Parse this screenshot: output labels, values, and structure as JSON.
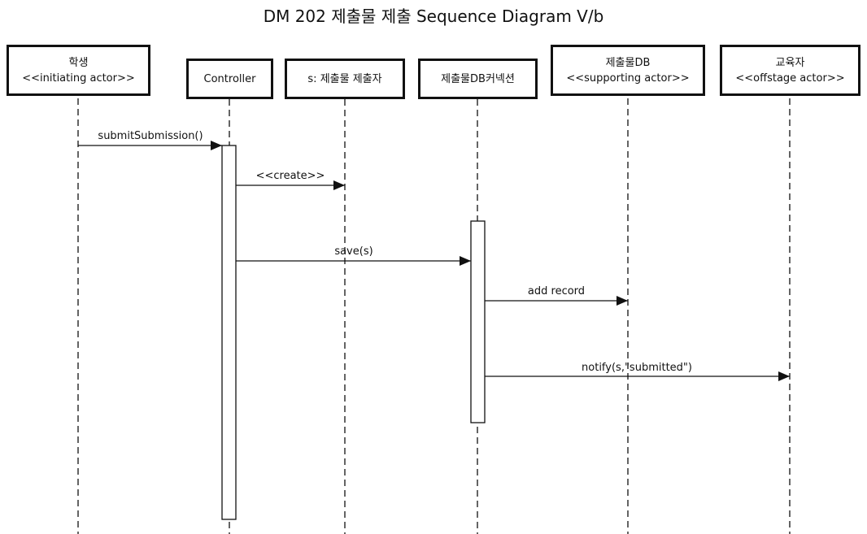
{
  "title": "DM 202 제출물 제출 Sequence Diagram V/b",
  "participants": [
    {
      "name": "학생",
      "stereotype": "<<initiating actor>>"
    },
    {
      "name": "Controller",
      "stereotype": ""
    },
    {
      "name": "s: 제출물 제출자",
      "stereotype": ""
    },
    {
      "name": "제출물DB커넥션",
      "stereotype": ""
    },
    {
      "name": "제출물DB",
      "stereotype": "<<supporting actor>>"
    },
    {
      "name": "교육자",
      "stereotype": "<<offstage actor>>"
    }
  ],
  "messages": [
    {
      "from": 0,
      "to": 1,
      "label": "submitSubmission()"
    },
    {
      "from": 1,
      "to": 2,
      "label": "<<create>>"
    },
    {
      "from": 1,
      "to": 3,
      "label": "save(s)"
    },
    {
      "from": 3,
      "to": 4,
      "label": "add record"
    },
    {
      "from": 3,
      "to": 5,
      "label": "notify(s,\"submitted\")"
    }
  ]
}
